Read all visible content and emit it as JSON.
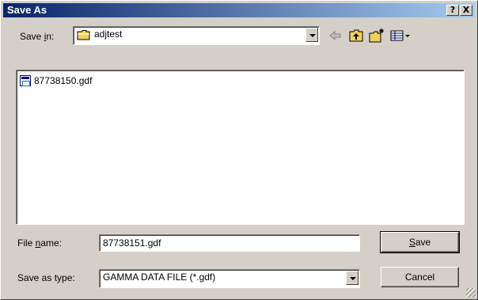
{
  "dialog": {
    "title": "Save As",
    "help_btn": "?",
    "close_btn": "X"
  },
  "save_in": {
    "label_pre": "Save ",
    "label_key": "i",
    "label_post": "n:",
    "value": "adjtest"
  },
  "toolbar": {
    "icons": [
      "back-arrow-icon",
      "up-folder-icon",
      "new-folder-icon",
      "view-menu-icon"
    ]
  },
  "files": [
    {
      "name": "87738150.gdf",
      "icon": "gdf-file-icon"
    }
  ],
  "file_name": {
    "label_pre": "File ",
    "label_key": "n",
    "label_post": "ame:",
    "value": "87738151.gdf"
  },
  "save_type": {
    "label": "Save as type:",
    "value": "GAMMA DATA FILE (*.gdf)"
  },
  "buttons": {
    "save_key": "S",
    "save_rest": "ave",
    "cancel": "Cancel"
  },
  "colors": {
    "title_start": "#0a246a",
    "title_end": "#a6caf0",
    "face": "#d4d0c8",
    "folder": "#f0d060"
  }
}
